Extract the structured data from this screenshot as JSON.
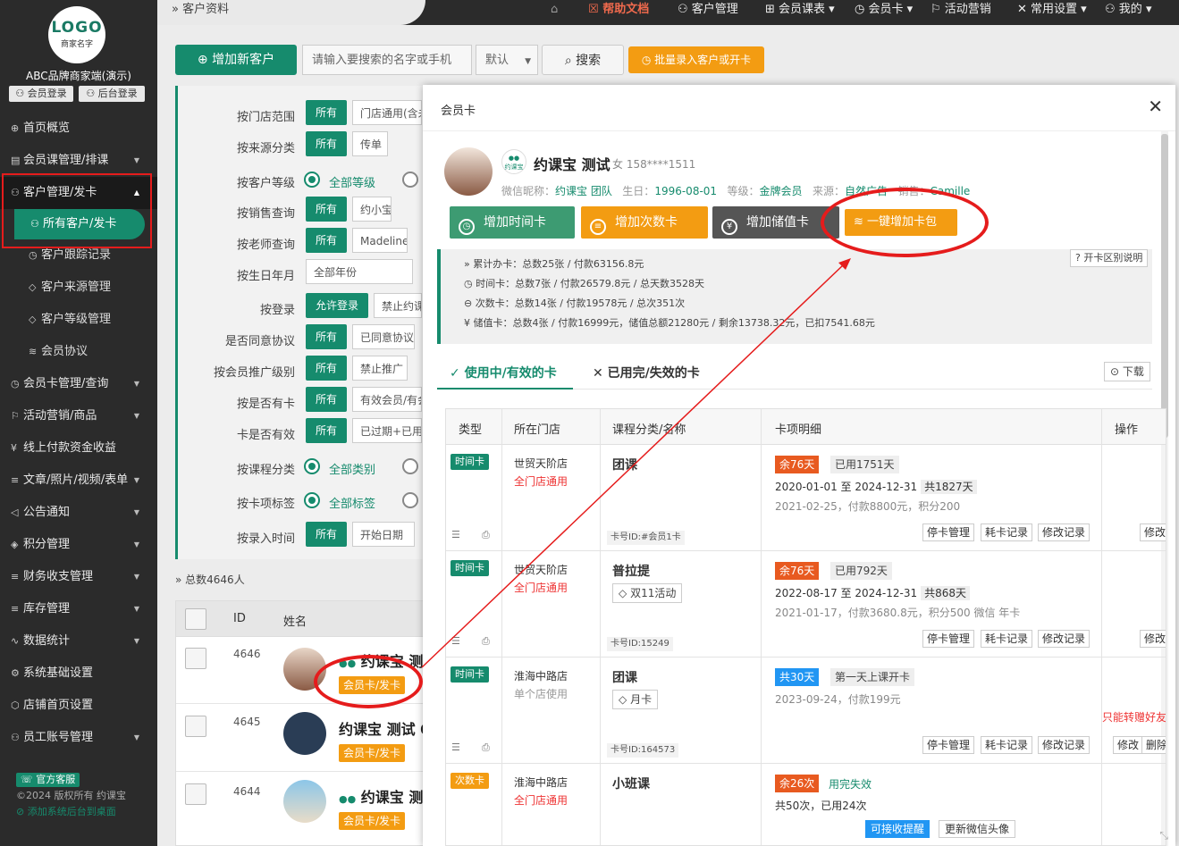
{
  "sidebar": {
    "logo_text": "LOGO",
    "logo_sub": "商家名字",
    "brand": "ABC品牌商家端(演示)",
    "member_login": "会员登录",
    "admin_login": "后台登录",
    "items": [
      {
        "label": "首页概览",
        "icon": "⊕"
      },
      {
        "label": "会员课管理/排课",
        "icon": "▤"
      },
      {
        "label": "客户管理/发卡",
        "icon": "⚇"
      },
      {
        "label": "所有客户/发卡",
        "icon": "⚇"
      },
      {
        "label": "客户跟踪记录",
        "icon": "◷"
      },
      {
        "label": "客户来源管理",
        "icon": "◇"
      },
      {
        "label": "客户等级管理",
        "icon": "◇"
      },
      {
        "label": "会员协议",
        "icon": "≋"
      },
      {
        "label": "会员卡管理/查询",
        "icon": "◷"
      },
      {
        "label": "活动营销/商品",
        "icon": "⚐"
      },
      {
        "label": "线上付款资金收益",
        "icon": "¥"
      },
      {
        "label": "文章/照片/视频/表单",
        "icon": "≡"
      },
      {
        "label": "公告通知",
        "icon": "◁"
      },
      {
        "label": "积分管理",
        "icon": "◈"
      },
      {
        "label": "财务收支管理",
        "icon": "≡"
      },
      {
        "label": "库存管理",
        "icon": "≡"
      },
      {
        "label": "数据统计",
        "icon": "∿"
      },
      {
        "label": "系统基础设置",
        "icon": "⚙"
      },
      {
        "label": "店铺首页设置",
        "icon": "⬡"
      },
      {
        "label": "员工账号管理",
        "icon": "⚇"
      }
    ],
    "service": "官方客服",
    "copyright": "©2024 版权所有 约课宝",
    "add_desktop": "添加系统后台到桌面"
  },
  "topbar": {
    "breadcrumb": "客户资料",
    "help": "帮助文档",
    "customer_mgmt": "客户管理",
    "course_table": "会员课表",
    "member_card": "会员卡",
    "marketing": "活动营销",
    "settings": "常用设置",
    "mine": "我的"
  },
  "toolbar": {
    "add_customer": "增加新客户",
    "search_placeholder": "请输入要搜索的名字或手机",
    "sort": "默认",
    "search": "搜索",
    "batch": "批量录入客户或开卡"
  },
  "filters": [
    {
      "label": "按门店范围",
      "all": "所有",
      "opt": "门店通用(含未"
    },
    {
      "label": "按来源分类",
      "all": "所有",
      "opt": "传单"
    },
    {
      "label": "按客户等级",
      "radio": "全部等级"
    },
    {
      "label": "按销售查询",
      "all": "所有",
      "opt": "约小宝"
    },
    {
      "label": "按老师查询",
      "all": "所有",
      "opt": "Madeline"
    },
    {
      "label": "按生日年月",
      "opt": "全部年份"
    },
    {
      "label": "按登录",
      "all": "允许登录",
      "opt": "禁止约课"
    },
    {
      "label": "是否同意协议",
      "all": "所有",
      "opt": "已同意协议"
    },
    {
      "label": "按会员推广级别",
      "all": "所有",
      "opt": "禁止推广"
    },
    {
      "label": "按是否有卡",
      "all": "所有",
      "opt": "有效会员/有会"
    },
    {
      "label": "卡是否有效",
      "all": "所有",
      "opt": "已过期+已用"
    },
    {
      "label": "按课程分类",
      "radio": "全部类别"
    },
    {
      "label": "按卡项标签",
      "radio": "全部标签"
    },
    {
      "label": "按录入时间",
      "all": "所有",
      "opt": "开始日期"
    }
  ],
  "list": {
    "total": "总数4646人",
    "col_id": "ID",
    "col_name": "姓名",
    "card_btn": "会员卡/发卡",
    "rows": [
      {
        "id": "4646",
        "name": "约课宝 测"
      },
      {
        "id": "4645",
        "name": "约课宝 测试 0"
      },
      {
        "id": "4644",
        "name": "约课宝 测"
      }
    ]
  },
  "modal": {
    "title": "会员卡",
    "customer": {
      "name": "约课宝 测试",
      "gender_phone": "女 158****1511",
      "app_label": "约课宝",
      "wechat_label": "微信昵称：",
      "wechat": "约课宝 团队",
      "birthday_label": "生日：",
      "birthday": "1996-08-01",
      "level_label": "等级：",
      "level": "金牌会员",
      "source_label": "来源：",
      "source": "自然广告",
      "sales_label": "销售：",
      "sales": "Camille"
    },
    "actions": {
      "time_card": "增加时间卡",
      "count_card": "增加次数卡",
      "value_card": "增加储值卡",
      "package": "一键增加卡包"
    },
    "stats": {
      "total": "累计办卡：总数25张 / 付款63156.8元",
      "time": "时间卡：总数7张 / 付款26579.8元 / 总天数3528天",
      "count": "次数卡：总数14张 / 付款19578元 / 总次351次",
      "value": "储值卡：总数4张 / 付款16999元，储值总额21280元 / 剩余13738.32元，已扣7541.68元"
    },
    "help": "开卡区别说明",
    "tab_active": "使用中/有效的卡",
    "tab_inactive": "已用完/失效的卡",
    "download": "下载",
    "columns": [
      "类型",
      "所在门店",
      "课程分类/名称",
      "卡项明细",
      "操作"
    ],
    "rows": [
      {
        "type": "时间卡",
        "shop": "世贸天阶店",
        "scope": "全门店通用",
        "course": "团课",
        "tag": "",
        "cardno": "卡号ID:#会员1卡",
        "remain": "余76天",
        "used": "已用1751天",
        "period": "2020-01-01 至 2024-12-31",
        "total": "共1827天",
        "pay": "2021-02-25，付款8800元，积分200"
      },
      {
        "type": "时间卡",
        "shop": "世贸天阶店",
        "scope": "全门店通用",
        "course": "普拉提",
        "tag": "双11活动",
        "cardno": "卡号ID:15249",
        "remain": "余76天",
        "used": "已用792天",
        "period": "2022-08-17 至 2024-12-31",
        "total": "共868天",
        "pay": "2021-01-17，付款3680.8元，积分500 微信 年卡"
      },
      {
        "type": "时间卡",
        "shop": "淮海中路店",
        "scope": "单个店使用",
        "course": "团课",
        "tag": "月卡",
        "cardno": "卡号ID:164573",
        "remain": "共30天",
        "used": "第一天上课开卡",
        "pay": "2023-09-24，付款199元",
        "warn": "只能转赠好友"
      },
      {
        "type": "次数卡",
        "shop": "淮海中路店",
        "scope": "全门店通用",
        "course": "小班课",
        "remain": "余26次",
        "status": "用完失效",
        "count": "共50次，已用24次"
      }
    ],
    "ops": {
      "stop": "停卡管理",
      "consume": "耗卡记录",
      "modify_log": "修改记录",
      "edit": "修改",
      "delete": "删除"
    },
    "bottom_btns": {
      "remind": "可接收提醒",
      "update_avatar": "更新微信头像"
    }
  },
  "colors": {
    "primary": "#168b6d",
    "orange": "#f39c12",
    "annotation": "#e51c1c"
  }
}
